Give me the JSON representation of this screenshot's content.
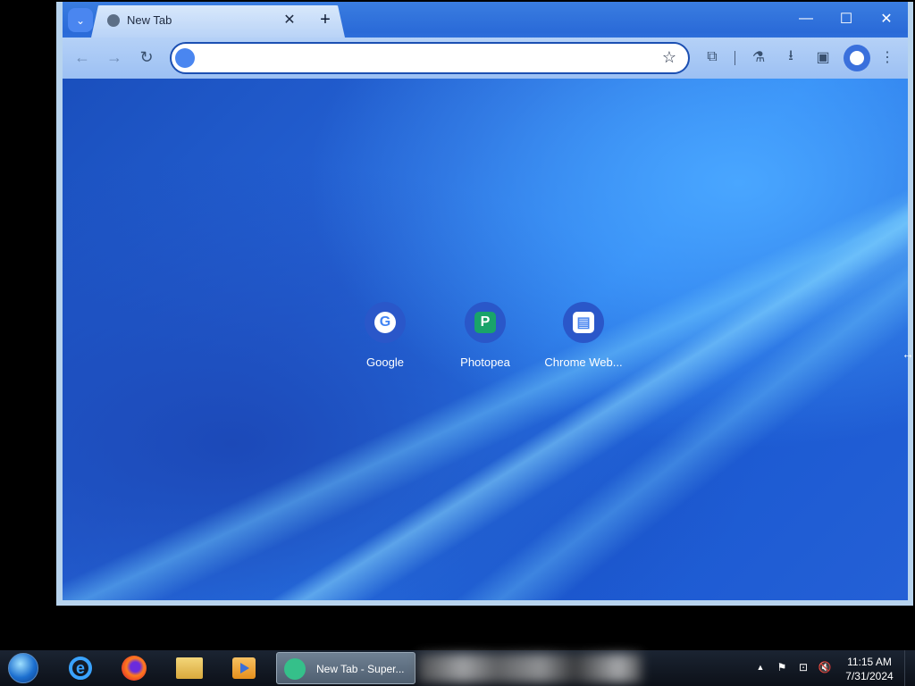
{
  "browser": {
    "tab": {
      "title": "New Tab",
      "close": "✕"
    },
    "new_tab": "+",
    "window_controls": {
      "minimize": "—",
      "maximize": "☐",
      "close": "✕"
    },
    "toolbar": {
      "back": "←",
      "forward": "→",
      "reload": "↻",
      "omnibox": {
        "value": "",
        "placeholder": ""
      },
      "bookmark": "☆",
      "extensions": "⧉",
      "labs": "⚗",
      "download": "⭳",
      "side_panel": "▣",
      "menu": "⋮"
    }
  },
  "shortcuts": [
    {
      "label": "Google",
      "glyph": "G",
      "color": "#4285f4"
    },
    {
      "label": "Photopea",
      "glyph": "P",
      "color": "#19a36a"
    },
    {
      "label": "Chrome Web...",
      "glyph": "▤",
      "color": "#4a86f0"
    }
  ],
  "taskbar": {
    "active_window": "New Tab - Super...",
    "ie_glyph": "e",
    "clock": {
      "time": "11:15 AM",
      "date": "7/31/2024"
    },
    "tray": {
      "arrow": "▲",
      "flag": "⚑",
      "network": "⊡",
      "volume": "🔇"
    }
  }
}
